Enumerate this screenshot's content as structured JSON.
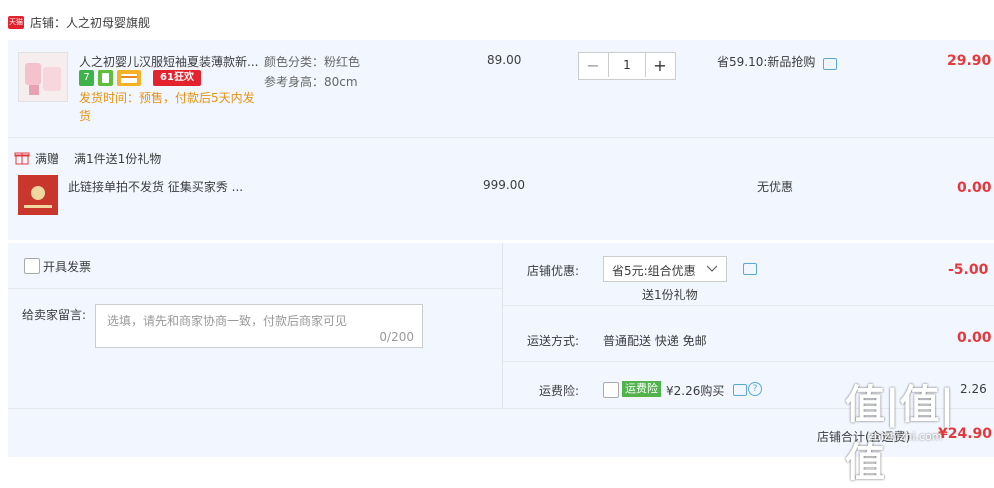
{
  "shop": {
    "badge": "天猫",
    "name": "店铺：人之初母婴旗舰"
  },
  "item": {
    "title": "人之初婴儿汉服短袖夏装薄款新...",
    "badges": [
      "7",
      "",
      "",
      "61狂欢"
    ],
    "ship_note": "发货时间：预售，付款后5天内发货",
    "attr_color": "颜色分类：粉红色",
    "attr_height": "参考身高：80cm",
    "unit_price": "89.00",
    "qty_minus": "−",
    "qty_value": "1",
    "qty_plus": "+",
    "promo": "省59.10:新品抢购",
    "subtotal": "29.90"
  },
  "gift": {
    "label": "满赠",
    "desc": "满1件送1份礼物",
    "title": "此链接单拍不发货 征集买家秀 ...",
    "unit_price": "999.00",
    "promo": "无优惠",
    "subtotal": "0.00"
  },
  "invoice": {
    "label": "开具发票"
  },
  "message": {
    "label": "给卖家留言:",
    "placeholder": "选填，请先和商家协商一致，付款后商家可见",
    "counter": "0/200"
  },
  "discount": {
    "label": "店铺优惠:",
    "value": "省5元:组合优惠",
    "sub": "送1份礼物",
    "amount": "-5.00"
  },
  "shipping": {
    "label": "运送方式:",
    "value": "普通配送 快递 免邮",
    "amount": "0.00"
  },
  "insurance": {
    "label": "运费险:",
    "badge": "运费险",
    "value": "¥2.26购买",
    "amount": "2.26"
  },
  "total": {
    "label": "店铺合计(含运费)",
    "amount": "¥24.90"
  },
  "watermark": {
    "big": "值|值|值",
    "small": "zhizhizhi.com"
  },
  "colors": {
    "price_red": "#e4393c",
    "panel_bg": "#f2f7ff",
    "brand_red": "#e4222d",
    "insurance_green": "#52b24c"
  }
}
